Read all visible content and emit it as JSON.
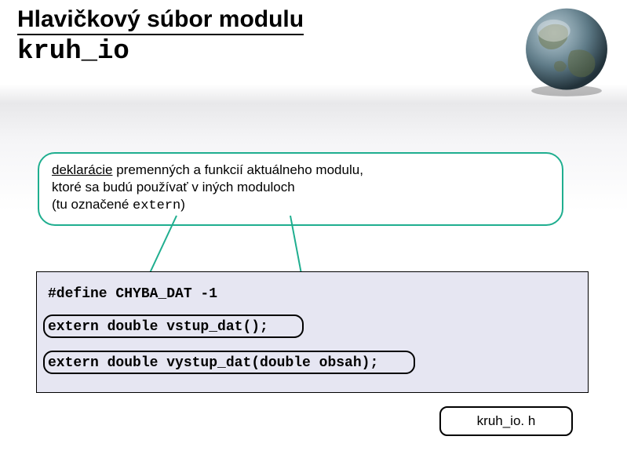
{
  "title": {
    "line1": "Hlavičkový súbor modulu",
    "line2": "kruh_io"
  },
  "callout": {
    "word1": "deklarácie",
    "rest1": " premenných a funkcií aktuálneho modulu,",
    "line2": "ktoré sa budú používať v iných moduloch",
    "line3a": "(tu označené ",
    "keyword": "extern",
    "line3b": ")"
  },
  "code": {
    "line1": "#define CHYBA_DAT -1",
    "line2": "extern double vstup_dat();",
    "line3": "extern double vystup_dat(double obsah);"
  },
  "filename": "kruh_io. h"
}
